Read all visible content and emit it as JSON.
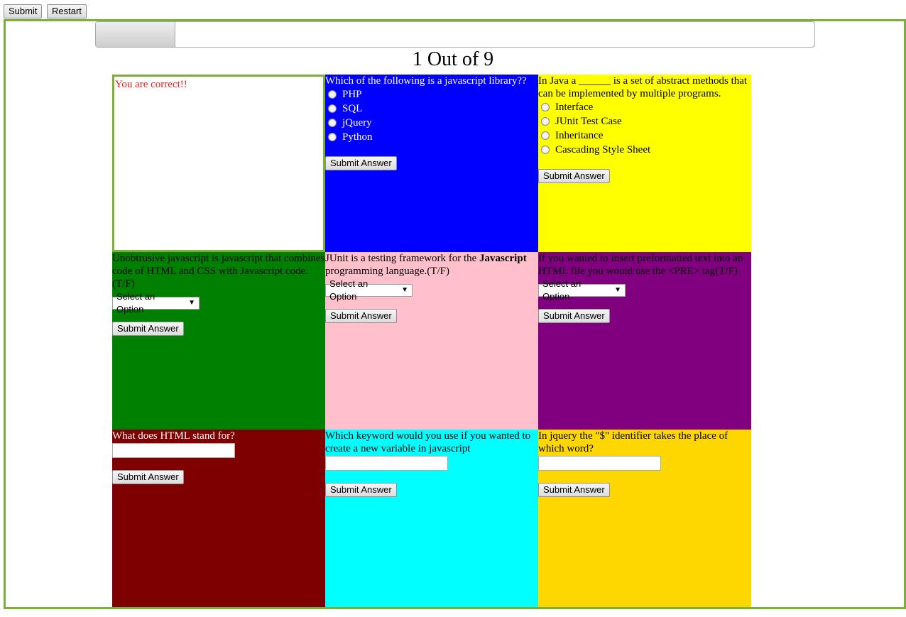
{
  "toolbar": {
    "submit_label": "Submit",
    "restart_label": "Restart"
  },
  "progress": {
    "current": 1,
    "total": 9,
    "fraction": 0.111
  },
  "counter_text": "1 Out of 9",
  "feedback": {
    "text": "You are correct!!"
  },
  "submit_answer_label": "Submit Answer",
  "colors": {
    "frame_border": "#7cae3a",
    "feedback_text": "#e81c1c",
    "feedback_border": "#7cae3a",
    "q1_bg": "#0000ff",
    "q2_bg": "#ffff00",
    "q3_bg": "#008000",
    "q4_bg": "#ffc0cb",
    "q5_bg": "#800080",
    "q6_bg": "#7f0000",
    "q7_bg": "#00ffff",
    "q8_bg": "#ffd700"
  },
  "questions": [
    {
      "text": "Which of the following is a javascript library??",
      "options": [
        "PHP",
        "SQL",
        "jQuery",
        "Python"
      ]
    },
    {
      "text": "In Java a ______ is a set of abstract methods that can be implemented by multiple programs.",
      "options": [
        "Interface",
        "JUnit Test Case",
        "Inheritance",
        "Cascading Style Sheet"
      ]
    },
    {
      "text": "Unobtrusive javascript is javascript that combines code of HTML and CSS with Javascript code.(T/F)",
      "select": "Select an Option"
    },
    {
      "text_before": "JUnit is a testing framework for the ",
      "text_bold": "Javascript",
      "text_after": " programming language.(T/F)",
      "select": "Select an Option"
    },
    {
      "text": "If you wanted to insert preformatted text into an HTML file you would use the <PRE> tag(T/F)",
      "select": "Select an Option"
    },
    {
      "text": "What does HTML stand for?"
    },
    {
      "text": "Which keyword would you use if you wanted to create a new variable in javascript"
    },
    {
      "text": "In jquery the \"$\" identifier takes the place of which word?"
    }
  ]
}
